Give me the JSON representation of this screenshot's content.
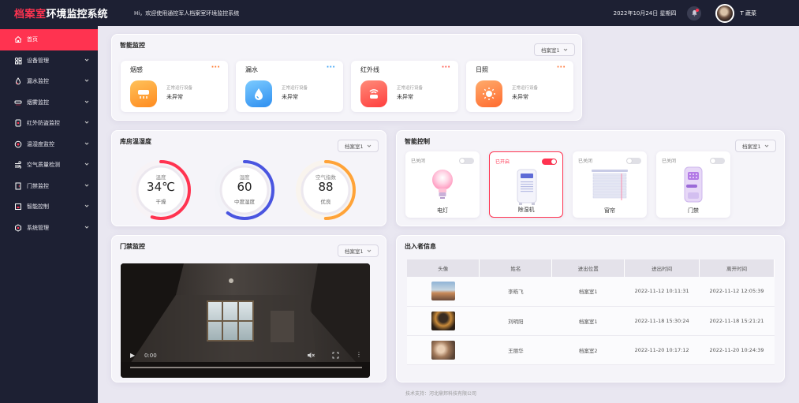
{
  "app": {
    "title_part1": "档案室",
    "title_part2": "环境监控系统",
    "welcome": "Hi，欢迎使用通控军人档案室环境监控系统",
    "datetime": "2022年10月24日  星期四",
    "user_name": "T 蔬菜"
  },
  "sidebar": {
    "items": [
      {
        "label": "首页",
        "active": true,
        "icon": "home-icon"
      },
      {
        "label": "设备管理",
        "icon": "devices-icon"
      },
      {
        "label": "漏水监控",
        "icon": "water-drop-icon"
      },
      {
        "label": "烟雾监控",
        "icon": "smoke-detector-icon"
      },
      {
        "label": "红外防盗监控",
        "icon": "infrared-icon"
      },
      {
        "label": "温湿度监控",
        "icon": "thermometer-icon"
      },
      {
        "label": "空气质量检测",
        "icon": "air-quality-icon"
      },
      {
        "label": "门禁监控",
        "icon": "door-icon"
      },
      {
        "label": "智能控制",
        "icon": "control-icon"
      },
      {
        "label": "系统管理",
        "icon": "settings-icon"
      }
    ]
  },
  "smart_monitor": {
    "title": "智能监控",
    "room_select": "档案室1",
    "cards": [
      {
        "name": "烟感",
        "sub": "正常运行设备",
        "status": "未异常",
        "color": "#ffa338",
        "dots": "#ff7a2f",
        "icon": "smoke-sensor-icon"
      },
      {
        "name": "漏水",
        "sub": "正常运行设备",
        "status": "未异常",
        "color": "#3fa4f5",
        "dots": "#3fa4f5",
        "icon": "water-drop-icon"
      },
      {
        "name": "红外线",
        "sub": "正常运行设备",
        "status": "未异常",
        "color": "#ff5a4f",
        "dots": "#ff5a4f",
        "icon": "infrared-sensor-icon"
      },
      {
        "name": "日照",
        "sub": "正常运行设备",
        "status": "未异常",
        "color": "#ff7f45",
        "dots": "#ff7f45",
        "icon": "sun-icon"
      }
    ]
  },
  "temp_humidity": {
    "title": "库房温湿度",
    "room_select": "档案室1",
    "gauges": [
      {
        "label": "温度",
        "value": "34℃",
        "desc": "干燥",
        "color": "#ff3350",
        "color2": "#ff8a9a",
        "fraction": 0.55
      },
      {
        "label": "湿度",
        "value": "60",
        "desc": "中度湿度",
        "color": "#4a55e0",
        "color2": "#a0a8ff",
        "fraction": 0.6
      },
      {
        "label": "空气指数",
        "value": "88",
        "desc": "优良",
        "color": "#ffa338",
        "color2": "#ffd08a",
        "fraction": 0.5
      }
    ]
  },
  "smart_control": {
    "title": "智能控制",
    "room_select": "档案室1",
    "devices": [
      {
        "name": "电灯",
        "status": "已关闭",
        "on": false,
        "icon": "light-bulb-icon"
      },
      {
        "name": "除湿机",
        "status": "已开启",
        "on": true,
        "icon": "dehumidifier-icon"
      },
      {
        "name": "窗帘",
        "status": "已关闭",
        "on": false,
        "icon": "curtain-icon"
      },
      {
        "name": "门禁",
        "status": "已关闭",
        "on": false,
        "icon": "door-lock-icon"
      }
    ]
  },
  "access_monitor": {
    "title": "门禁监控",
    "room_select": "档案室1",
    "video_time": "0:00"
  },
  "visitors": {
    "title": "出入者信息",
    "columns": [
      "头像",
      "姓名",
      "进出位置",
      "进出时间",
      "离开时间"
    ],
    "rows": [
      {
        "name": "李皓飞",
        "location": "档案室1",
        "in": "2022-11-12 10:11:31",
        "out": "2022-11-12 12:05:39"
      },
      {
        "name": "刘明阳",
        "location": "档案室1",
        "in": "2022-11-18 15:30:24",
        "out": "2022-11-18 15:21:21"
      },
      {
        "name": "王丽华",
        "location": "档案室2",
        "in": "2022-11-20 10:17:12",
        "out": "2022-11-20 10:24:39"
      }
    ]
  },
  "footer": "技术支持：河北鼎邦科技有限公司"
}
